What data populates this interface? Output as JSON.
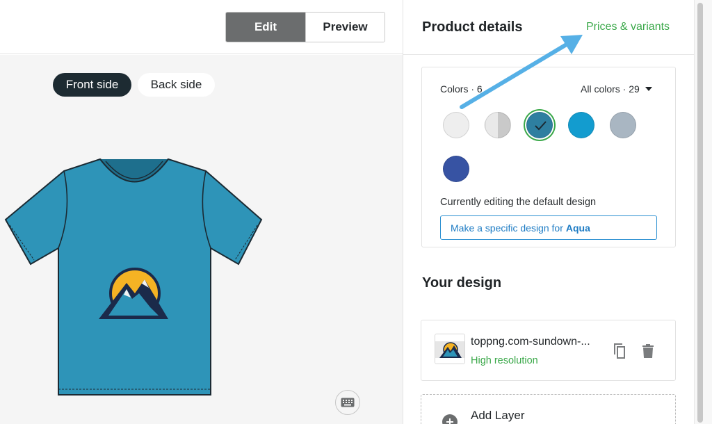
{
  "toolbar": {
    "edit_label": "Edit",
    "preview_label": "Preview"
  },
  "canvas": {
    "front_label": "Front side",
    "back_label": "Back side",
    "shirt_color": "#2e94b8"
  },
  "panel": {
    "title": "Product details",
    "prices_link": "Prices & variants",
    "colors_count": "Colors · 6",
    "all_colors": "All colors · 29",
    "swatches": [
      {
        "name": "White",
        "color": "#eeeeee"
      },
      {
        "name": "Heather Grey",
        "color": "#cfcfcf"
      },
      {
        "name": "Aqua",
        "color": "#2e7fa0",
        "selected": true
      },
      {
        "name": "Cyan",
        "color": "#139ccf"
      },
      {
        "name": "Light Blue Grey",
        "color": "#a9b6c2"
      },
      {
        "name": "Royal Heather",
        "color": "#3753a3"
      }
    ],
    "editing_text": "Currently editing the default design",
    "specific_prefix": "Make a specific design for",
    "specific_color": "Aqua"
  },
  "design": {
    "title": "Your design",
    "layer_name": "toppng.com-sundown-...",
    "layer_quality": "High resolution",
    "add_layer": "Add Layer"
  },
  "colors": {
    "accent_green": "#3aa849",
    "link_blue": "#1e7cc4",
    "arrow_blue": "#56b0e6"
  }
}
